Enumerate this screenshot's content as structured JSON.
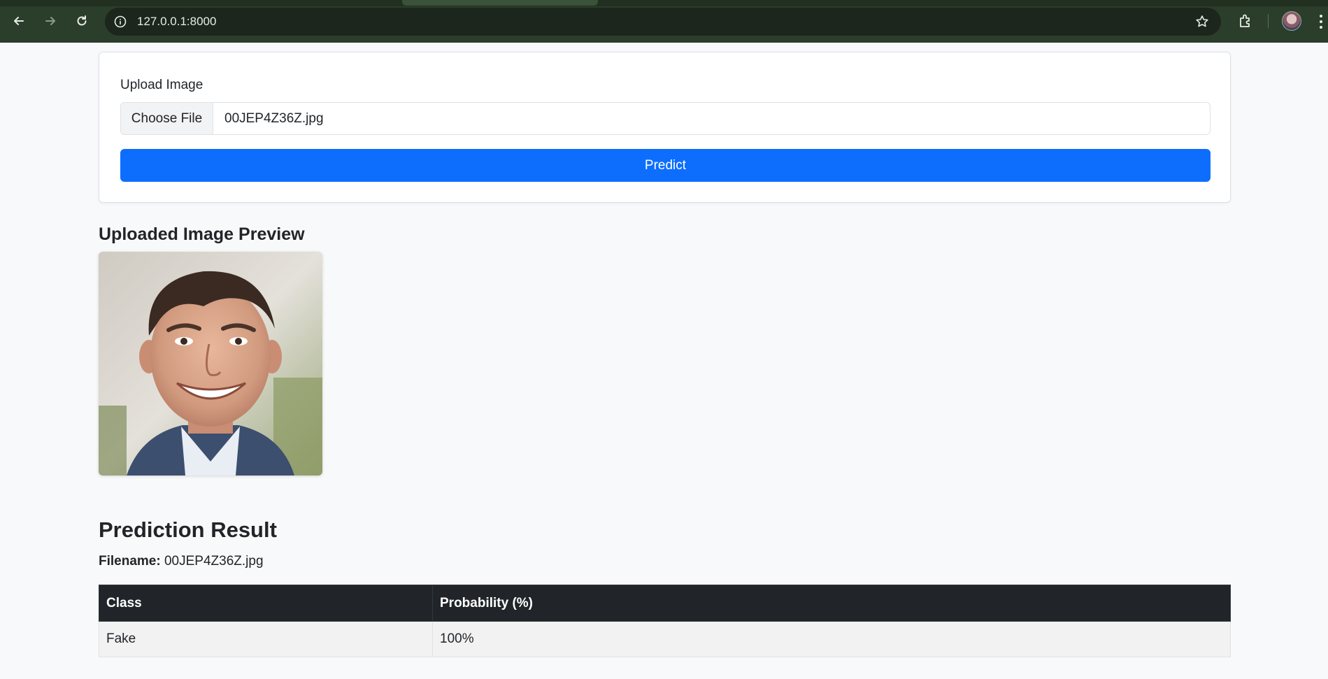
{
  "browser": {
    "url": "127.0.0.1:8000",
    "icons": [
      "back-arrow-icon",
      "forward-arrow-icon",
      "reload-icon",
      "info-icon",
      "star-icon",
      "extensions-icon",
      "profile-avatar",
      "menu-dots-icon"
    ]
  },
  "upload": {
    "label": "Upload Image",
    "choose_file_label": "Choose File",
    "selected_file": "00JEP4Z36Z.jpg",
    "predict_label": "Predict"
  },
  "preview": {
    "heading": "Uploaded Image Preview"
  },
  "result": {
    "heading": "Prediction Result",
    "filename_label": "Filename:",
    "filename_value": "00JEP4Z36Z.jpg",
    "table": {
      "headers": [
        "Class",
        "Probability (%)"
      ],
      "rows": [
        [
          "Fake",
          "100%"
        ]
      ]
    }
  },
  "colors": {
    "primary": "#0d6efd",
    "table_header": "#212529",
    "chrome": "#2b3d2b"
  }
}
